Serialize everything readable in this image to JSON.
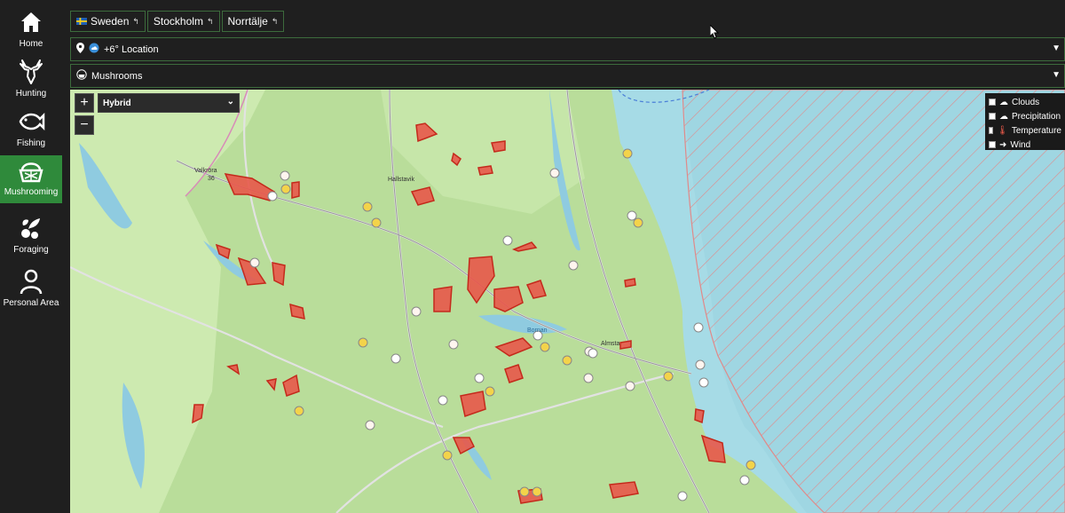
{
  "sidebar": {
    "items": [
      {
        "label": "Home",
        "icon": "home-icon",
        "active": false
      },
      {
        "label": "Hunting",
        "icon": "deer-icon",
        "active": false
      },
      {
        "label": "Fishing",
        "icon": "fish-icon",
        "active": false
      },
      {
        "label": "Mushrooming",
        "icon": "mushroom-basket-icon",
        "active": true
      },
      {
        "label": "Foraging",
        "icon": "berries-icon",
        "active": false
      },
      {
        "label": "Personal Area",
        "icon": "person-icon",
        "active": false
      }
    ],
    "active_color": "#2f8a3b"
  },
  "breadcrumbs": {
    "country": "Sweden",
    "region": "Stockholm",
    "municipality": "Norrtälje"
  },
  "location_bar": {
    "text": "+6° Location"
  },
  "category_bar": {
    "text": "Mushrooms"
  },
  "map": {
    "zoom_in": "+",
    "zoom_out": "−",
    "layer_selected": "Hybrid",
    "weather_layers": [
      "Clouds",
      "Precipitation",
      "Temperature",
      "Wind"
    ],
    "places": [
      "Valkröra",
      "36",
      "Hallstavik",
      "Almsta",
      "Bornan"
    ],
    "colors": {
      "land": "#b9dd9a",
      "water": "#a6dbe6",
      "zone": "#e23a2e",
      "restricted": "#e08a8a"
    }
  }
}
